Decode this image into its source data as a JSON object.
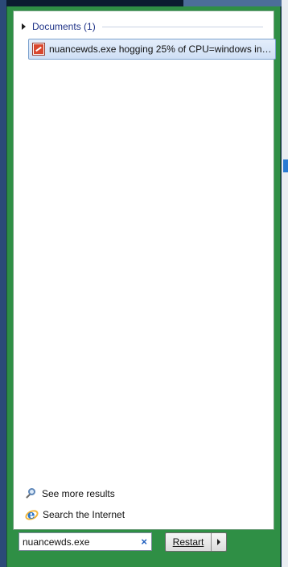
{
  "documents_group": {
    "title": "Documents (1)"
  },
  "results": [
    {
      "text": "nuancewds.exe hogging 25% of CPU=windows ind..."
    }
  ],
  "links": {
    "see_more": "See more results",
    "search_internet": "Search the Internet"
  },
  "search": {
    "value": "nuancewds.exe",
    "clear_glyph": "×"
  },
  "power": {
    "restart_label": "Restart"
  },
  "colors": {
    "frame": "#2f8f45",
    "group_title": "#1e3287",
    "selection": "#cfdff5"
  }
}
